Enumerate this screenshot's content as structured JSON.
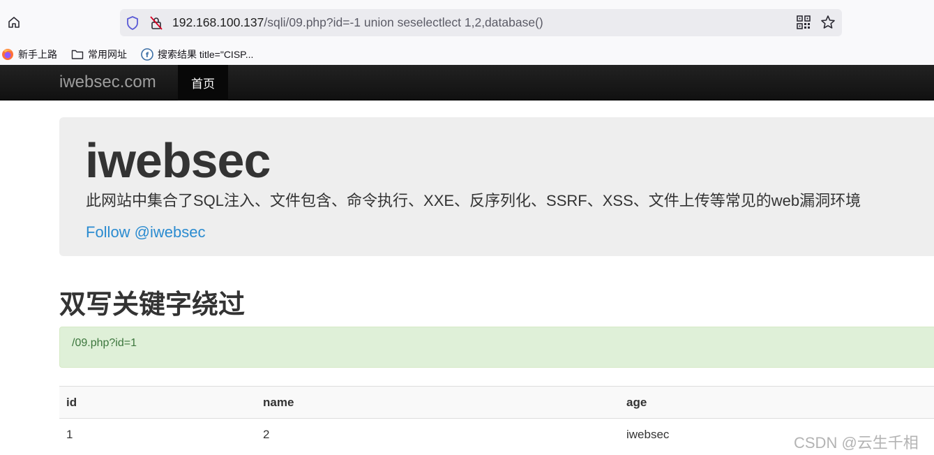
{
  "browser": {
    "url_host": "192.168.100.137",
    "url_path": "/sqli/09.php?id=-1 union seselectlect 1,2,database()",
    "icons": [
      "home-icon",
      "shield-icon",
      "insecure-lock-icon",
      "qr-code-icon",
      "star-icon"
    ],
    "bookmarks": [
      {
        "label": "新手上路",
        "icon": "firefox-icon"
      },
      {
        "label": "常用网址",
        "icon": "folder-icon"
      },
      {
        "label": "搜索结果 title=\"CISP...",
        "icon": "search-result-icon"
      }
    ]
  },
  "navbar": {
    "brand": "iwebsec.com",
    "active_item": "首页"
  },
  "jumbotron": {
    "title": "iwebsec",
    "description": "此网站中集合了SQL注入、文件包含、命令执行、XXE、反序列化、SSRF、XSS、文件上传等常见的web漏洞环境",
    "follow_link": "Follow @iwebsec"
  },
  "section": {
    "title": "双写关键字绕过",
    "alert": "/09.php?id=1"
  },
  "table": {
    "headers": [
      "id",
      "name",
      "age"
    ],
    "rows": [
      [
        "1",
        "2",
        "iwebsec"
      ]
    ]
  },
  "watermark": "CSDN @云生千相",
  "colors": {
    "navbar_bg": "#111111",
    "jumbotron_bg": "#eeeeee",
    "link": "#2a8bd0",
    "alert_bg": "#dff0d8",
    "alert_text": "#3c763d"
  }
}
